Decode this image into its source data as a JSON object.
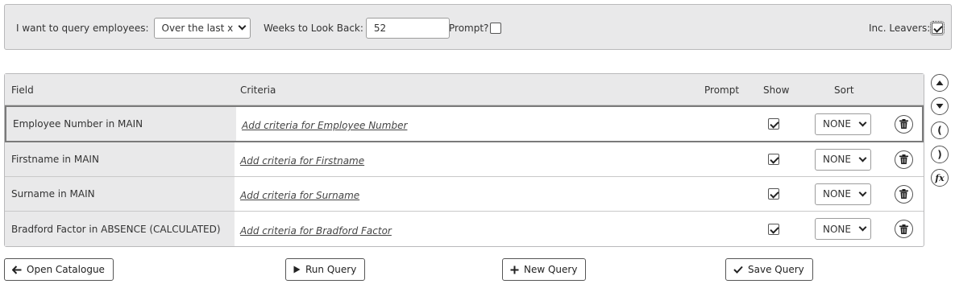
{
  "filter": {
    "query_label": "I want to query employees:",
    "query_value": "Over the last x weeks",
    "weeks_label": "Weeks to Look Back:",
    "weeks_value": "52",
    "prompt_label": "Prompt?",
    "prompt_checked": false,
    "leavers_label": "Inc. Leavers:",
    "leavers_checked": true
  },
  "grid": {
    "headers": {
      "field": "Field",
      "criteria": "Criteria",
      "prompt": "Prompt",
      "show": "Show",
      "sort": "Sort"
    },
    "rows": [
      {
        "field": "Employee Number in MAIN",
        "criteria": "Add criteria for Employee Number",
        "show": true,
        "sort": "NONE",
        "selected": true
      },
      {
        "field": "Firstname in MAIN",
        "criteria": "Add criteria for Firstname",
        "show": true,
        "sort": "NONE",
        "selected": false
      },
      {
        "field": "Surname in MAIN",
        "criteria": "Add criteria for Surname",
        "show": true,
        "sort": "NONE",
        "selected": false
      },
      {
        "field": "Bradford Factor in ABSENCE (CALCULATED)",
        "criteria": "Add criteria for Bradford Factor",
        "show": true,
        "sort": "NONE",
        "selected": false
      }
    ]
  },
  "side_buttons": {
    "open_paren": "(",
    "close_paren": ")",
    "function": "fx"
  },
  "buttons": {
    "open_catalogue": "Open Catalogue",
    "run_query": "Run Query",
    "new_query": "New Query",
    "save_query": "Save Query"
  },
  "icons": {
    "move_up": "move-up-icon",
    "move_down": "move-down-icon",
    "delete": "trash-icon",
    "back": "arrow-left-icon",
    "run": "play-icon",
    "new": "plus-icon",
    "save": "check-icon"
  }
}
